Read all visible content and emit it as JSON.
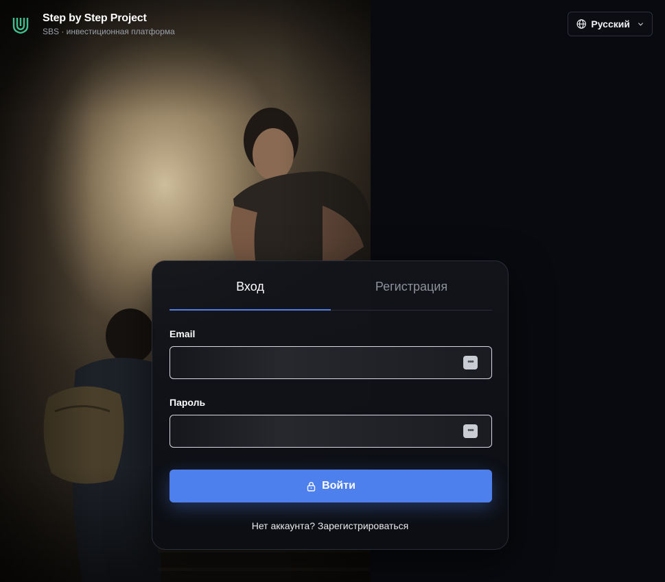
{
  "brand": {
    "title": "Step by Step Project",
    "subtitle": "SBS · инвестиционная платформа",
    "accent_color": "#3fbf8f"
  },
  "language": {
    "selected": "Русский",
    "icon": "globe-icon"
  },
  "auth": {
    "tabs": [
      {
        "label": "Вход",
        "active": true
      },
      {
        "label": "Регистрация",
        "active": false
      }
    ],
    "email_label": "Email",
    "email_value": "",
    "password_label": "Пароль",
    "password_value": "",
    "submit_label": "Войти",
    "no_account_text": "Нет аккаунта?",
    "register_link": "Зарегистрироваться",
    "accent_color": "#4d7fed"
  }
}
